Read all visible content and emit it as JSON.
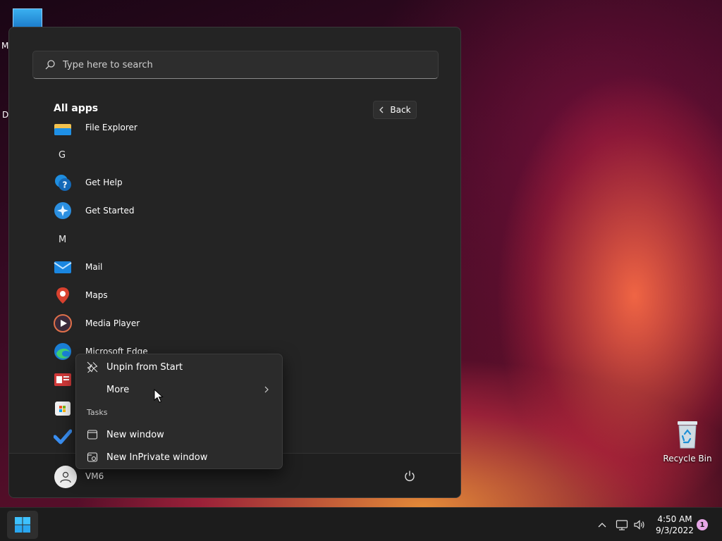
{
  "desktop": {
    "partial_label_1": "M",
    "partial_label_2": "Da",
    "recycle_bin_label": "Recycle Bin"
  },
  "start_menu": {
    "search_placeholder": "Type here to search",
    "all_apps_title": "All apps",
    "back_label": "Back",
    "apps": [
      {
        "label": "File Explorer",
        "icon": "folder-icon"
      },
      {
        "letter": "G"
      },
      {
        "label": "Get Help",
        "icon": "help-icon"
      },
      {
        "label": "Get Started",
        "icon": "get-started-icon"
      },
      {
        "letter": "M"
      },
      {
        "label": "Mail",
        "icon": "mail-icon"
      },
      {
        "label": "Maps",
        "icon": "maps-pin-icon"
      },
      {
        "label": "Media Player",
        "icon": "media-player-icon"
      },
      {
        "label": "Microsoft Edge",
        "icon": "edge-icon"
      },
      {
        "label": "",
        "icon": "news-icon"
      },
      {
        "label": "",
        "icon": "store-icon"
      },
      {
        "label": "",
        "icon": "todo-check-icon"
      }
    ],
    "user_name": "VM6"
  },
  "context_menu": {
    "unpin_label": "Unpin from Start",
    "more_label": "More",
    "tasks_header": "Tasks",
    "new_window_label": "New window",
    "new_inprivate_label": "New InPrivate window"
  },
  "taskbar": {
    "time": "4:50 AM",
    "date": "9/3/2022",
    "notification_count": "1"
  },
  "colors": {
    "accent": "#0078d4",
    "menu_bg": "#242424",
    "context_bg": "#2b2b2b"
  }
}
